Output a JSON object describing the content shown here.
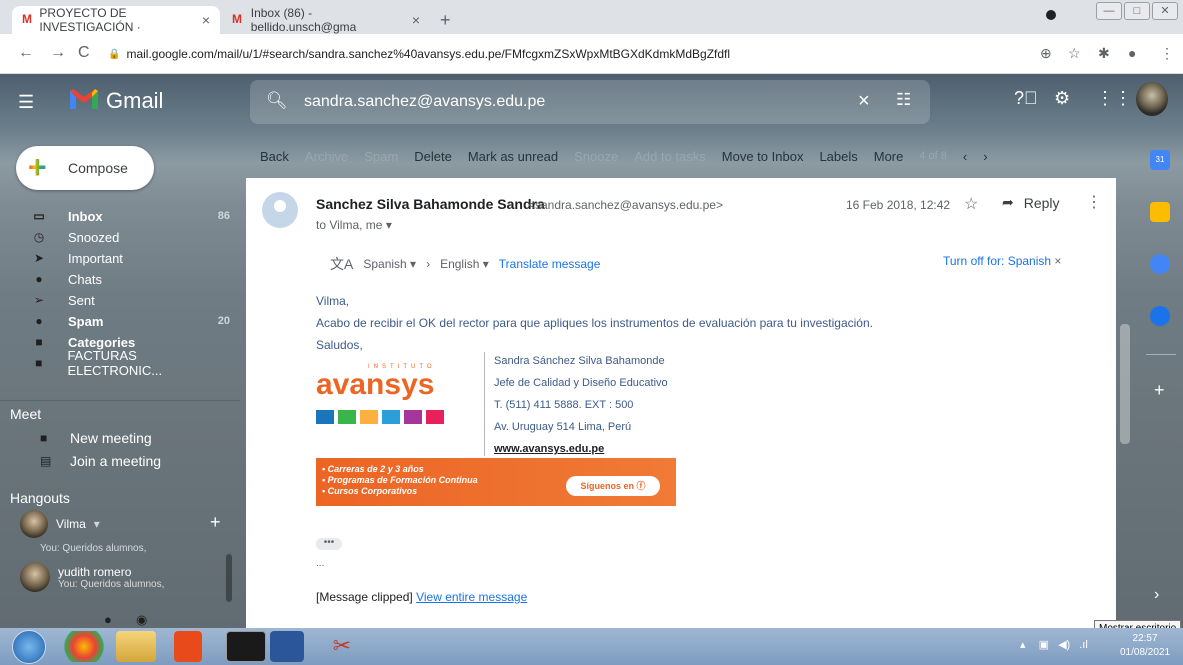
{
  "browser": {
    "tabs": [
      {
        "title": "PROYECTO DE INVESTIGACIÓN ·",
        "active": true
      },
      {
        "title": "Inbox (86) - bellido.unsch@gma",
        "active": false
      }
    ],
    "url": "mail.google.com/mail/u/1/#search/sandra.sanchez%40avansys.edu.pe/FMfcgxmZSxWpxMtBGXdKdmkMdBgZfdfl"
  },
  "gmail": {
    "brand": "Gmail",
    "search_value": "sandra.sanchez@avansys.edu.pe",
    "compose_label": "Compose",
    "sidebar": [
      {
        "label": "Inbox",
        "count": "86",
        "bold": true
      },
      {
        "label": "Snoozed",
        "count": ""
      },
      {
        "label": "Important",
        "count": ""
      },
      {
        "label": "Chats",
        "count": ""
      },
      {
        "label": "Sent",
        "count": ""
      },
      {
        "label": "Spam",
        "count": "20",
        "bold": true
      },
      {
        "label": "Categories",
        "count": "",
        "bold": true
      },
      {
        "label": "FACTURAS ELECTRONIC...",
        "count": ""
      }
    ],
    "meet": {
      "heading": "Meet",
      "new_meeting": "New meeting",
      "join_meeting": "Join a meeting"
    },
    "hangouts": {
      "heading": "Hangouts",
      "current_user": "Vilma",
      "prev_snippet": "You:  Queridos alumnos,",
      "contact_name": "yudith romero",
      "contact_snippet": "You:  Queridos alumnos,"
    },
    "toolbar": [
      "Back",
      "Archive",
      "Spam",
      "Delete",
      "Mark as unread",
      "Snooze",
      "Add to tasks",
      "Move to Inbox",
      "Labels",
      "More",
      "4 of 8"
    ],
    "email": {
      "sender_name": "Sanchez Silva Bahamonde Sandra",
      "sender_email": "<sandra.sanchez@avansys.edu.pe>",
      "to_line": "to Vilma, me",
      "date": "16 Feb 2018, 12:42",
      "reply_label": "Reply",
      "translate": {
        "from": "Spanish",
        "to": "English",
        "link": "Translate message",
        "turn_off": "Turn off for: Spanish"
      },
      "body": [
        "Vilma,",
        "Acabo de recibir el OK del rector para que apliques los instrumentos de evaluación para tu investigación.",
        "Saludos,"
      ],
      "signature": {
        "logo_top": "INSTITUTO",
        "logo_word": "avansys",
        "name": "Sandra Sánchez Silva Bahamonde",
        "title": "Jefe de Calidad y Diseño Educativo",
        "phone": "T. (511) 411 5888. EXT : 500",
        "address": "Av. Uruguay 514 Lima, Perú",
        "web": "www.avansys.edu.pe",
        "banner_lines": [
          "• Carreras de 2 y 3 años",
          "• Programas de Formación Continua",
          "• Cursos Corporativos"
        ],
        "banner_button": "Síguenos en"
      },
      "dots": "•••",
      "ellipsis": "...",
      "clipped_text": "[Message clipped]",
      "clipped_link": "View entire message"
    }
  },
  "os": {
    "tooltip": "Mostrar escritorio",
    "clock_time": "22:57",
    "clock_date": "01/08/2021"
  },
  "colors": {
    "accent_blue": "#1a73e8",
    "gmail_red": "#d93025",
    "avansys_orange": "#ec6525"
  }
}
